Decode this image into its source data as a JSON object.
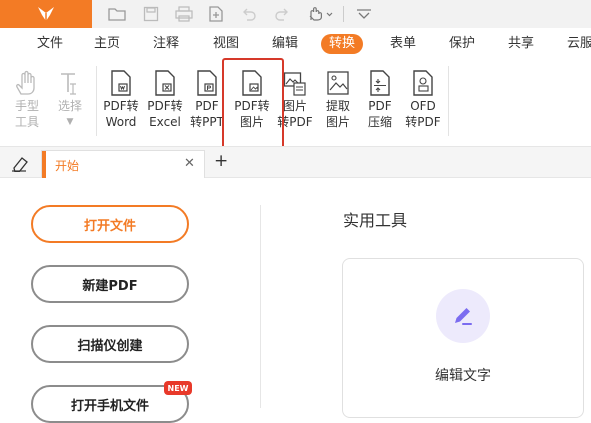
{
  "colors": {
    "accent": "#f37b25",
    "highlight": "#d6392a",
    "badge": "#e8392a",
    "card_icon_bg": "#edeafc",
    "card_icon": "#7b6cf0"
  },
  "menu": {
    "items": [
      "文件",
      "主页",
      "注释",
      "视图",
      "编辑",
      "转换",
      "表单",
      "保护",
      "共享",
      "云服"
    ],
    "active": "转换"
  },
  "ribbon": {
    "hand": {
      "line1": "手型",
      "line2": "工具"
    },
    "select": {
      "line1": "选择"
    },
    "pdf_to_word": {
      "line1": "PDF转",
      "line2": "Word"
    },
    "pdf_to_excel": {
      "line1": "PDF转",
      "line2": "Excel"
    },
    "pdf_to_ppt": {
      "line1": "PDF",
      "line2": "转PPT"
    },
    "pdf_to_image": {
      "line1": "PDF转",
      "line2": "图片"
    },
    "image_to_pdf": {
      "line1": "图片",
      "line2": "转PDF"
    },
    "extract_image": {
      "line1": "提取",
      "line2": "图片"
    },
    "pdf_compress": {
      "line1": "PDF",
      "line2": "压缩"
    },
    "ofd_to_pdf": {
      "line1": "OFD",
      "line2": "转PDF"
    }
  },
  "tabs": {
    "start_label": "开始",
    "add_label": "+"
  },
  "actions": {
    "open_file": "打开文件",
    "new_pdf": "新建PDF",
    "scanner_create": "扫描仪创建",
    "open_phone_file": "打开手机文件",
    "new_badge": "NEW"
  },
  "tools_section": {
    "title": "实用工具",
    "card_label": "编辑文字"
  }
}
